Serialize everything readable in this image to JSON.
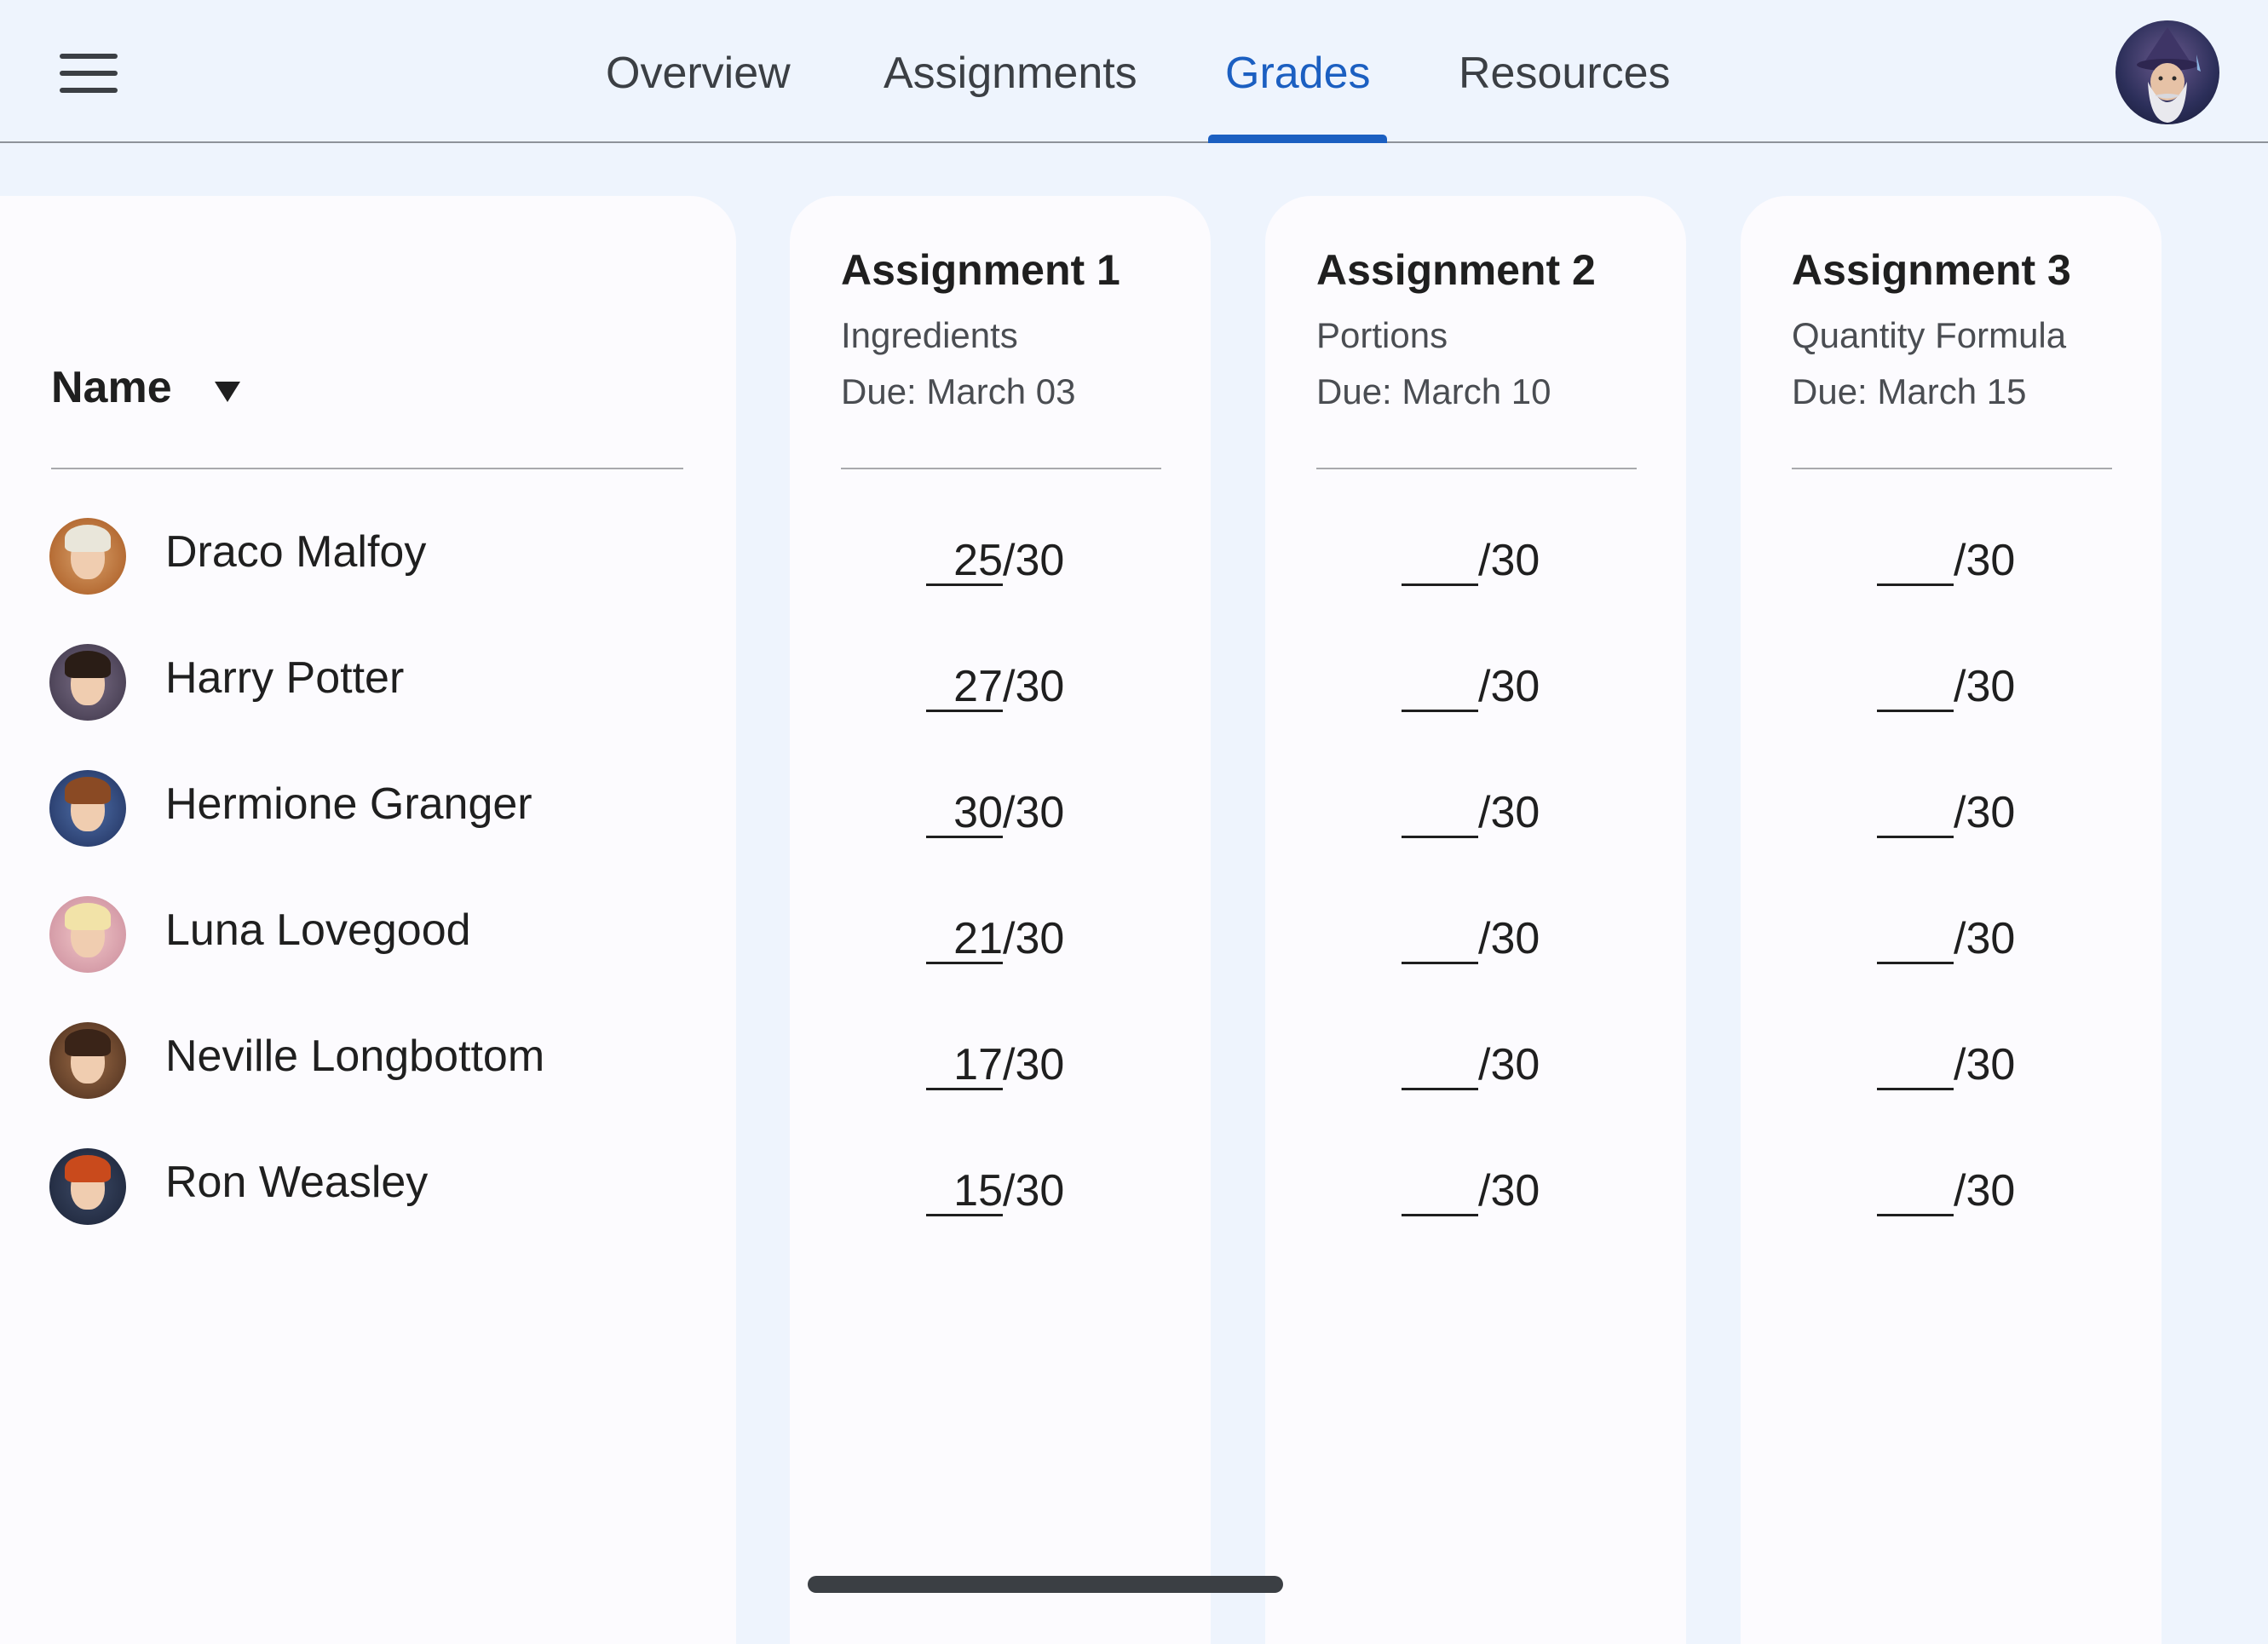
{
  "nav": {
    "tabs": [
      {
        "label": "Overview"
      },
      {
        "label": "Assignments"
      },
      {
        "label": "Grades"
      },
      {
        "label": "Resources"
      }
    ],
    "active_tab": "Grades",
    "menu_icon": "hamburger-menu-icon",
    "accent_color": "#1b5fc1"
  },
  "table": {
    "name_header": "Name",
    "sort_icon": "triangle-down-icon",
    "assignments": [
      {
        "title": "Assignment 1",
        "subtitle": "Ingredients",
        "due": "Due: March 03"
      },
      {
        "title": "Assignment 2",
        "subtitle": "Portions",
        "due": "Due: March 10"
      },
      {
        "title": "Assignment 3",
        "subtitle": "Quantity Formula",
        "due": "Due: March 15"
      }
    ],
    "grade_total": "/30",
    "students": [
      {
        "name": "Draco Malfoy",
        "grades": [
          "25",
          "",
          ""
        ]
      },
      {
        "name": "Harry Potter",
        "grades": [
          "27",
          "",
          ""
        ]
      },
      {
        "name": "Hermione Granger",
        "grades": [
          "30",
          "",
          ""
        ]
      },
      {
        "name": "Luna Lovegood",
        "grades": [
          "21",
          "",
          ""
        ]
      },
      {
        "name": "Neville Longbottom",
        "grades": [
          "17",
          "",
          ""
        ]
      },
      {
        "name": "Ron Weasley",
        "grades": [
          "15",
          "",
          ""
        ]
      }
    ]
  }
}
